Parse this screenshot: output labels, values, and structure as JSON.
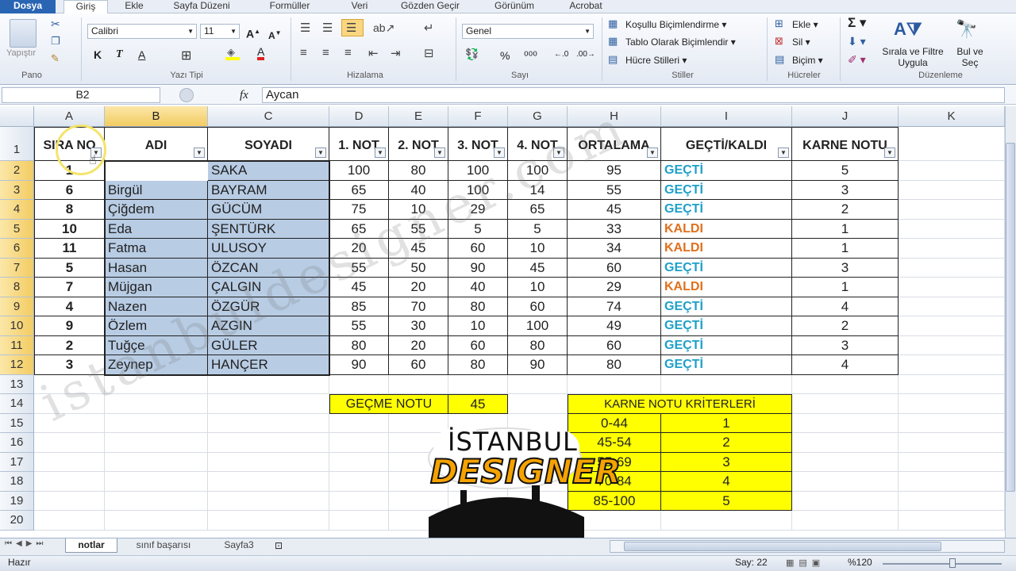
{
  "ribbon_tabs": [
    "Dosya",
    "Giriş",
    "Ekle",
    "Sayfa Düzeni",
    "Formüller",
    "Veri",
    "Gözden Geçir",
    "Görünüm",
    "Acrobat"
  ],
  "clipboard": {
    "paste_label": "Yapıştır",
    "group": "Pano"
  },
  "font": {
    "name": "Calibri",
    "size": "11",
    "bold": "K",
    "italic": "T",
    "underline": "A",
    "group": "Yazı Tipi"
  },
  "alignment": {
    "group": "Hizalama"
  },
  "number": {
    "format": "Genel",
    "percent": "%",
    "group": "Sayı"
  },
  "styles": {
    "conditional": "Koşullu Biçimlendirme",
    "as_table": "Tablo Olarak Biçimlendir",
    "cell_styles": "Hücre Stilleri",
    "group": "Stiller"
  },
  "cells": {
    "insert": "Ekle",
    "delete": "Sil",
    "format": "Biçim",
    "group": "Hücreler"
  },
  "editing": {
    "sort_filter": "Sırala ve Filtre Uygula",
    "find_select": "Bul ve Seç",
    "group": "Düzenleme"
  },
  "formula_bar": {
    "name_box": "B2",
    "fx": "fx",
    "content": "Aycan"
  },
  "columns": [
    "A",
    "B",
    "C",
    "D",
    "E",
    "F",
    "G",
    "H",
    "I",
    "J",
    "K"
  ],
  "row_numbers": [
    "1",
    "2",
    "3",
    "4",
    "5",
    "6",
    "7",
    "8",
    "9",
    "10",
    "11",
    "12",
    "13",
    "14",
    "15",
    "16",
    "17",
    "18",
    "19",
    "20"
  ],
  "table_headers": [
    "SIRA NO",
    "ADI",
    "SOYADI",
    "1. NOT",
    "2. NOT",
    "3. NOT",
    "4. NOT",
    "ORTALAMA",
    "GEÇTİ/KALDI",
    "KARNE NOTU"
  ],
  "rows": [
    [
      "1",
      "Aycan",
      "SAKA",
      "100",
      "80",
      "100",
      "100",
      "95",
      "GEÇTİ",
      "5"
    ],
    [
      "6",
      "Birgül",
      "BAYRAM",
      "65",
      "40",
      "100",
      "14",
      "55",
      "GEÇTİ",
      "3"
    ],
    [
      "8",
      "Çiğdem",
      "GÜCÜM",
      "75",
      "10",
      "29",
      "65",
      "45",
      "GEÇTİ",
      "2"
    ],
    [
      "10",
      "Eda",
      "ŞENTÜRK",
      "65",
      "55",
      "5",
      "5",
      "33",
      "KALDI",
      "1"
    ],
    [
      "11",
      "Fatma",
      "ULUSOY",
      "20",
      "45",
      "60",
      "10",
      "34",
      "KALDI",
      "1"
    ],
    [
      "5",
      "Hasan",
      "ÖZCAN",
      "55",
      "50",
      "90",
      "45",
      "60",
      "GEÇTİ",
      "3"
    ],
    [
      "7",
      "Müjgan",
      "ÇALGIN",
      "45",
      "20",
      "40",
      "10",
      "29",
      "KALDI",
      "1"
    ],
    [
      "4",
      "Nazen",
      "ÖZGÜR",
      "85",
      "70",
      "80",
      "60",
      "74",
      "GEÇTİ",
      "4"
    ],
    [
      "9",
      "Özlem",
      "AZGIN",
      "55",
      "30",
      "10",
      "100",
      "49",
      "GEÇTİ",
      "2"
    ],
    [
      "2",
      "Tuğçe",
      "GÜLER",
      "80",
      "20",
      "60",
      "80",
      "60",
      "GEÇTİ",
      "3"
    ],
    [
      "3",
      "Zeynep",
      "HANÇER",
      "90",
      "60",
      "80",
      "90",
      "80",
      "GEÇTİ",
      "4"
    ]
  ],
  "passing": {
    "label": "GEÇME NOTU",
    "value": "45"
  },
  "criteria": {
    "title": "KARNE NOTU KRİTERLERİ",
    "items": [
      [
        "0-44",
        "1"
      ],
      [
        "45-54",
        "2"
      ],
      [
        "55-69",
        "3"
      ],
      [
        "70-84",
        "4"
      ],
      [
        "85-100",
        "5"
      ]
    ]
  },
  "sheets": [
    "notlar",
    "sınıf başarısı",
    "Sayfa3"
  ],
  "status": {
    "ready": "Hazır",
    "count": "Say: 22",
    "zoom": "%120"
  },
  "logo_text": [
    "İSTANBUL",
    "DESIGNER"
  ],
  "watermark": "istanbuldesigner.com",
  "colors": {
    "gecti": "#1fa0c8",
    "kaldi": "#e0701c",
    "selection": "#b8cce4",
    "highlight": "#ffff00"
  }
}
